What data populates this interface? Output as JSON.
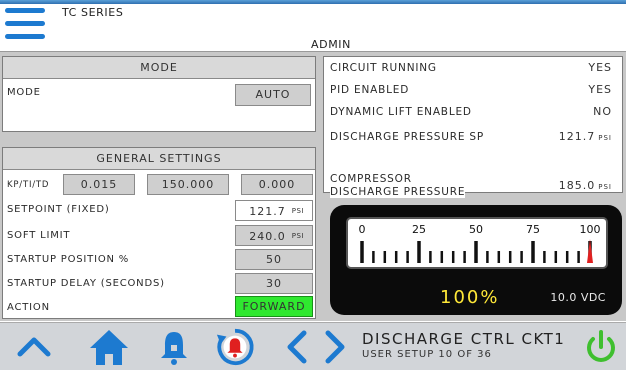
{
  "header": {
    "series": "TC SERIES",
    "user": "ADMIN"
  },
  "mode_panel": {
    "title": "MODE",
    "label": "MODE",
    "value": "AUTO"
  },
  "general_settings": {
    "title": "GENERAL SETTINGS",
    "pid_label": "KP/TI/TD",
    "kp": "0.015",
    "ti": "150.000",
    "td": "0.000",
    "setpoint_label": "SETPOINT (FIXED)",
    "setpoint_value": "121.7",
    "setpoint_unit": "PSI",
    "soft_limit_label": "SOFT LIMIT",
    "soft_limit_value": "240.0",
    "soft_limit_unit": "PSI",
    "startup_position_label": "STARTUP POSITION %",
    "startup_position_value": "50",
    "startup_delay_label": "STARTUP DELAY (SECONDS)",
    "startup_delay_value": "30",
    "action_label": "ACTION",
    "action_value": "FORWARD"
  },
  "status": {
    "circuit_running_label": "CIRCUIT RUNNING",
    "circuit_running_value": "YES",
    "pid_enabled_label": "PID ENABLED",
    "pid_enabled_value": "YES",
    "dynamic_lift_label": "DYNAMIC LIFT ENABLED",
    "dynamic_lift_value": "NO",
    "discharge_sp_label": "DISCHARGE PRESSURE SP",
    "discharge_sp_value": "121.7",
    "discharge_sp_unit": "PSI",
    "compressor_label_1": "COMPRESSOR",
    "compressor_label_2": "DISCHARGE PRESSURE",
    "compressor_value": "185.0",
    "compressor_unit": "PSI"
  },
  "gauge": {
    "tick_labels": [
      "0",
      "25",
      "50",
      "75",
      "100"
    ],
    "percent": 100,
    "readout": "100%",
    "voltage": "10.0 VDC",
    "needle_color": "#e02020",
    "readout_color": "#ffe838"
  },
  "footer": {
    "screen_title": "DISCHARGE CTRL CKT1",
    "screen_subtitle": "USER SETUP 10 OF 36",
    "icons": [
      "chevron-up-icon",
      "home-icon",
      "bell-icon",
      "alarm-reset-icon",
      "chevron-left-icon",
      "chevron-right-icon",
      "power-icon"
    ],
    "accent": "#1d7ad0",
    "alarm_color": "#e02020",
    "power_color": "#3fbf2f"
  }
}
